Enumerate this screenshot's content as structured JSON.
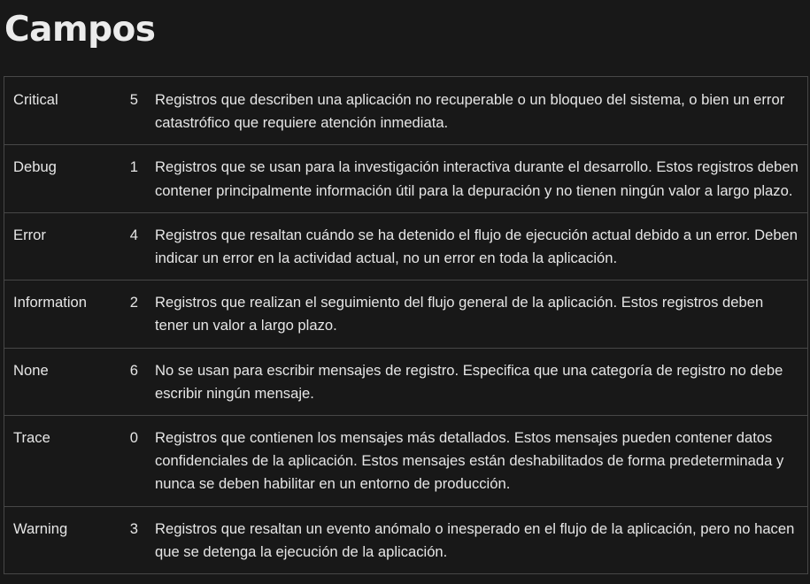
{
  "page": {
    "title": "Campos"
  },
  "fields": [
    {
      "name": "Critical",
      "value": "5",
      "description": "Registros que describen una aplicación no recuperable o un bloqueo del sistema, o bien un error catastrófico que requiere atención inmediata."
    },
    {
      "name": "Debug",
      "value": "1",
      "description": "Registros que se usan para la investigación interactiva durante el desarrollo. Estos registros deben contener principalmente información útil para la depuración y no tienen ningún valor a largo plazo."
    },
    {
      "name": "Error",
      "value": "4",
      "description": "Registros que resaltan cuándo se ha detenido el flujo de ejecución actual debido a un error. Deben indicar un error en la actividad actual, no un error en toda la aplicación."
    },
    {
      "name": "Information",
      "value": "2",
      "description": "Registros que realizan el seguimiento del flujo general de la aplicación. Estos registros deben tener un valor a largo plazo."
    },
    {
      "name": "None",
      "value": "6",
      "description": "No se usan para escribir mensajes de registro. Especifica que una categoría de registro no debe escribir ningún mensaje."
    },
    {
      "name": "Trace",
      "value": "0",
      "description": "Registros que contienen los mensajes más detallados. Estos mensajes pueden contener datos confidenciales de la aplicación. Estos mensajes están deshabilitados de forma predeterminada y nunca se deben habilitar en un entorno de producción."
    },
    {
      "name": "Warning",
      "value": "3",
      "description": "Registros que resaltan un evento anómalo o inesperado en el flujo de la aplicación, pero no hacen que se detenga la ejecución de la aplicación."
    }
  ]
}
